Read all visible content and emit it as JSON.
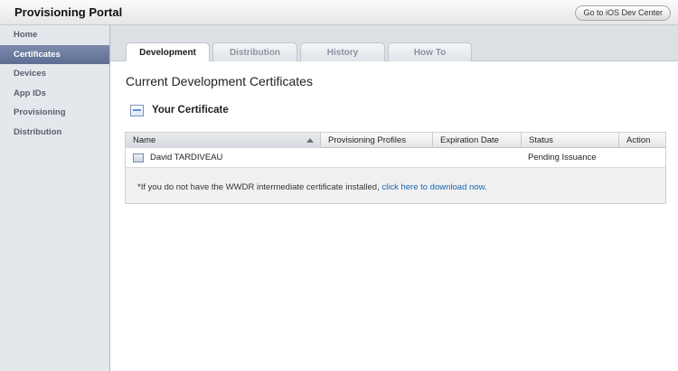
{
  "header": {
    "title": "Provisioning Portal",
    "dev_center_label": "Go to iOS Dev Center"
  },
  "sidebar": {
    "items": [
      {
        "label": "Home"
      },
      {
        "label": "Certificates",
        "active": true
      },
      {
        "label": "Devices"
      },
      {
        "label": "App IDs"
      },
      {
        "label": "Provisioning"
      },
      {
        "label": "Distribution"
      }
    ]
  },
  "tabs": [
    {
      "label": "Development",
      "active": true
    },
    {
      "label": "Distribution"
    },
    {
      "label": "History"
    },
    {
      "label": "How To"
    }
  ],
  "main": {
    "title": "Current Development Certificates",
    "section_title": "Your Certificate",
    "table": {
      "columns": [
        "Name",
        "Provisioning Profiles",
        "Expiration Date",
        "Status",
        "Action"
      ],
      "rows": [
        {
          "name": "David TARDIVEAU",
          "provisioning_profiles": "",
          "expiration_date": "",
          "status": "Pending Issuance",
          "action": ""
        }
      ]
    },
    "note": {
      "text_before": "*If you do not have the WWDR intermediate certificate installed, ",
      "link_text": "click here to download now",
      "text_after": "."
    }
  },
  "colors": {
    "sidebar_active": "#6b7b9f",
    "link": "#1566b5",
    "sidebar_bg": "#e4e7ec"
  }
}
